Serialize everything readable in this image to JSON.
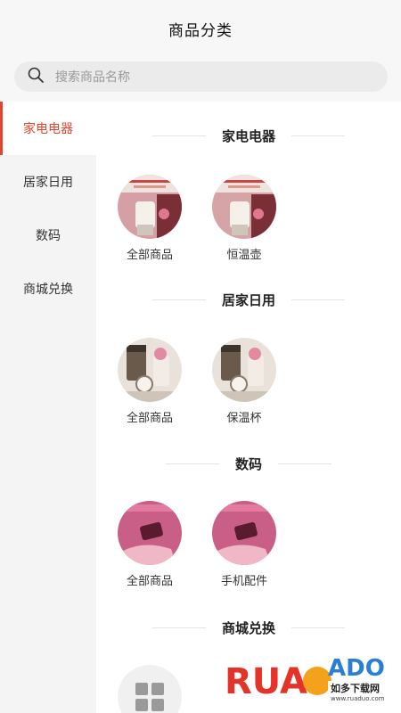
{
  "header": {
    "title": "商品分类"
  },
  "search": {
    "placeholder": "搜索商品名称",
    "icon": "search-icon"
  },
  "sidebar": {
    "items": [
      {
        "label": "家电电器",
        "active": true
      },
      {
        "label": "居家日用",
        "active": false
      },
      {
        "label": "数码",
        "active": false
      },
      {
        "label": "商城兑换",
        "active": false
      }
    ]
  },
  "sections": [
    {
      "title": "家电电器",
      "items": [
        {
          "label": "全部商品"
        },
        {
          "label": "恒温壶"
        }
      ]
    },
    {
      "title": "居家日用",
      "items": [
        {
          "label": "全部商品"
        },
        {
          "label": "保温杯"
        }
      ]
    },
    {
      "title": "数码",
      "items": [
        {
          "label": "全部商品"
        },
        {
          "label": "手机配件"
        }
      ]
    },
    {
      "title": "商城兑换",
      "items": [
        {
          "icon": "grid-icon"
        }
      ]
    }
  ],
  "watermark": {
    "brand": "RUANDADO",
    "sub": "如多下载网",
    "url": "www.ruaduo.com"
  },
  "colors": {
    "accent": "#e2452e",
    "sidebar_bg": "#f4f4f4",
    "header_bg": "#f7f7f7"
  }
}
